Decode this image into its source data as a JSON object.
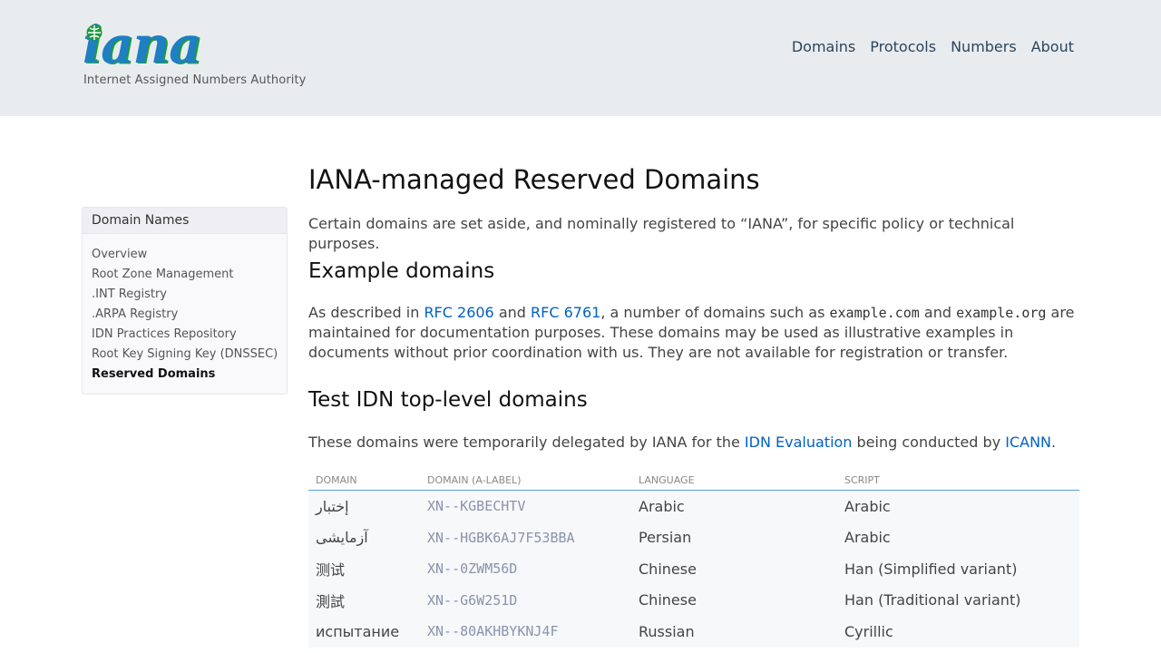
{
  "header": {
    "logo_text": "iana",
    "logo_tagline": "Internet Assigned Numbers Authority",
    "nav": [
      "Domains",
      "Protocols",
      "Numbers",
      "About"
    ]
  },
  "sidebar": {
    "title": "Domain Names",
    "items": [
      "Overview",
      "Root Zone Management",
      ".INT Registry",
      ".ARPA Registry",
      "IDN Practices Repository",
      "Root Key Signing Key (DNSSEC)",
      "Reserved Domains"
    ],
    "active_index": 6
  },
  "main": {
    "title": "IANA-managed Reserved Domains",
    "intro": "Certain domains are set aside, and nominally registered to “IANA”, for specific policy or technical purposes.",
    "example": {
      "heading": "Example domains",
      "t1": "As described in ",
      "link1": "RFC 2606",
      "t2": " and ",
      "link2": "RFC 6761",
      "t3": ", a number of domains such as ",
      "code1": "example.com",
      "t4": " and ",
      "code2": "example.org",
      "t5": " are maintained for documentation purposes. These domains may be used as illustrative examples in documents without prior coordination with us. They are not available for registration or transfer."
    },
    "test": {
      "heading": "Test IDN top-level domains",
      "t1": "These domains were temporarily delegated by IANA for the ",
      "link1": "IDN Evaluation",
      "t2": " being conducted by ",
      "link2": "ICANN",
      "t3": "."
    },
    "table": {
      "headers": [
        "DOMAIN",
        "DOMAIN (A-LABEL)",
        "LANGUAGE",
        "SCRIPT"
      ],
      "rows": [
        [
          "إختبار",
          "XN--KGBECHTV",
          "Arabic",
          "Arabic"
        ],
        [
          "آزمایشی",
          "XN--HGBK6AJ7F53BBA",
          "Persian",
          "Arabic"
        ],
        [
          "测试",
          "XN--0ZWM56D",
          "Chinese",
          "Han (Simplified variant)"
        ],
        [
          "測試",
          "XN--G6W251D",
          "Chinese",
          "Han (Traditional variant)"
        ],
        [
          "испытание",
          "XN--80AKHBYKNJ4F",
          "Russian",
          "Cyrillic"
        ]
      ]
    }
  },
  "colors": {
    "header_bg": "#e9ecee",
    "link": "#0061c3",
    "logo_blue": "#1e7fc2",
    "logo_green": "#1d9c3a",
    "table_rule": "#5b9fd4"
  }
}
